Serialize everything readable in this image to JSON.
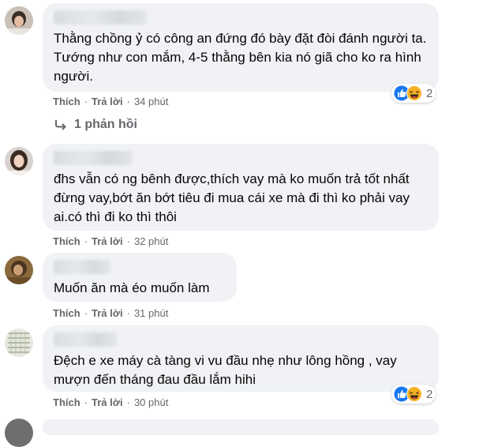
{
  "comments": [
    {
      "text": "Thằng chồng ỷ có công an đứng đó bày đặt đòi đánh người ta. Tướng như con mắm, 4-5 thằng bên kia nó giã cho ko ra hình người.",
      "like": "Thích",
      "reply": "Trả lời",
      "time": "34 phút",
      "reaction_count": "2",
      "reaction_icons": [
        "like-icon",
        "haha-icon"
      ],
      "replies_label": "1 phản hồi"
    },
    {
      "text": "đhs vẫn có ng bênh được,thích vay mà ko muốn trả tốt nhất đừng vay,bớt ăn bớt tiêu đi mua cái xe mà đi thì ko phải vay ai.có thì đi ko thì thôi",
      "like": "Thích",
      "reply": "Trả lời",
      "time": "32 phút"
    },
    {
      "text": "Muốn ăn mà éo muốn làm",
      "like": "Thích",
      "reply": "Trả lời",
      "time": "31 phút"
    },
    {
      "text": "Đệch e xe máy cà tàng vi vu đầu nhẹ như lông hồng , vay mượn đến tháng đau đầu lắm hihi",
      "like": "Thích",
      "reply": "Trả lời",
      "time": "30 phút",
      "reaction_count": "2",
      "reaction_icons": [
        "like-icon",
        "haha-icon"
      ]
    }
  ],
  "colors": {
    "bubble": "#f0f2f5",
    "meta": "#65676b",
    "text": "#050505",
    "like_blue": "#1877f2",
    "haha_yellow": "#f7b125"
  }
}
